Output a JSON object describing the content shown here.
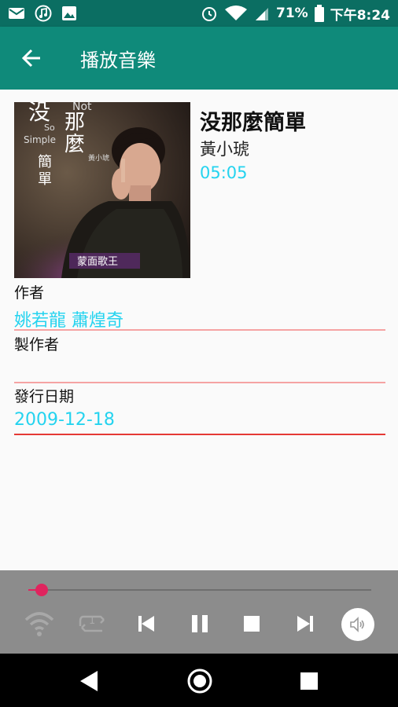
{
  "status_bar": {
    "battery": "71%",
    "time": "下午8:24"
  },
  "app_bar": {
    "title": "播放音樂"
  },
  "song": {
    "title": "没那麼簡單",
    "artist": "黃小琥",
    "duration": "05:05"
  },
  "cover": {
    "text_lines": [
      "没",
      "那",
      "麼",
      "簡",
      "單",
      "Not",
      "So",
      "Simple",
      "黃小琥",
      "蒙面歌王"
    ]
  },
  "details": {
    "composer_label": "作者",
    "composer_value": "姚若龍 蕭煌奇",
    "producer_label": "製作者",
    "producer_value": "",
    "release_label": "發行日期",
    "release_value": "2009-12-18"
  },
  "player": {
    "progress": 0.04,
    "repeat_count": "1"
  },
  "colors": {
    "status_bar": "#0b6e62",
    "app_bar": "#0f8a7a",
    "accent_cyan": "#24d3ef",
    "divider_pink": "#f5a3a3",
    "divider_red": "#e53935",
    "seek_accent": "#e0245e",
    "player_bg": "#8c8c8c"
  },
  "icons": {
    "status_left": [
      "mail-icon",
      "music-note-icon",
      "image-icon"
    ],
    "status_right": [
      "alarm-icon",
      "wifi-icon",
      "signal-icon",
      "battery-icon"
    ],
    "player": [
      "wifi-stream-icon",
      "repeat-one-icon",
      "skip-previous-icon",
      "pause-icon",
      "stop-icon",
      "skip-next-icon",
      "volume-icon"
    ],
    "nav": [
      "back-triangle-icon",
      "home-circle-icon",
      "recents-square-icon"
    ]
  }
}
